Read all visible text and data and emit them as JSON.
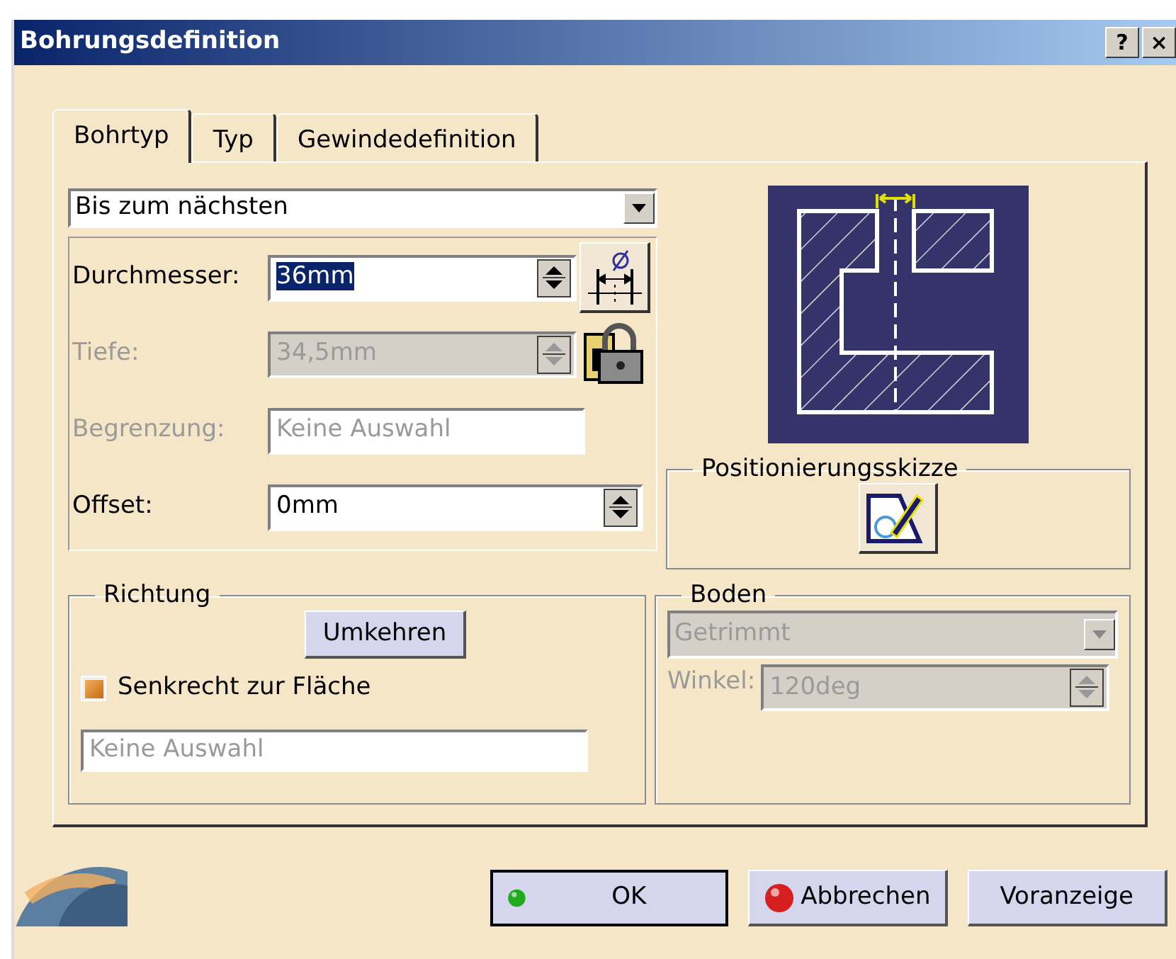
{
  "window": {
    "title": "Bohrungsdefinition",
    "help": "?",
    "close": "×"
  },
  "tabs": [
    {
      "label": "Bohrtyp",
      "selected": true
    },
    {
      "label": "Typ",
      "selected": false
    },
    {
      "label": "Gewindedefinition",
      "selected": false
    }
  ],
  "limit_type": {
    "value": "Bis zum nächsten"
  },
  "fields": [
    {
      "kind": "spin",
      "label": "Durchmesser:",
      "value": "36mm",
      "disabled": false,
      "highlighted": true,
      "extra": {
        "kind": "diameter"
      }
    },
    {
      "kind": "spin",
      "label": "Tiefe:",
      "value": "34,5mm",
      "disabled": true,
      "highlighted": false,
      "extra": {
        "kind": "lock"
      }
    },
    {
      "kind": "text",
      "label": "Begrenzung:",
      "value": "Keine Auswahl",
      "disabled": true,
      "highlighted": false
    },
    {
      "kind": "spin",
      "label": "Offset:",
      "value": "0mm",
      "disabled": false,
      "highlighted": false
    }
  ],
  "positioning": {
    "title": "Positionierungsskizze"
  },
  "direction": {
    "title": "Richtung",
    "button": "Umkehren",
    "checkbox": {
      "label": "Senkrecht zur Fläche",
      "checked": true
    },
    "field": "Keine Auswahl"
  },
  "bottom": {
    "title": "Boden",
    "dropdown": {
      "value": "Getrimmt",
      "disabled": true
    },
    "angle": {
      "label": "Winkel:",
      "value": "120deg",
      "disabled": true
    }
  },
  "buttons": [
    {
      "label": "OK",
      "kind": "ok"
    },
    {
      "label": "Abbrechen",
      "kind": "cancel"
    },
    {
      "label": "Voranzeige",
      "kind": "plain"
    }
  ]
}
